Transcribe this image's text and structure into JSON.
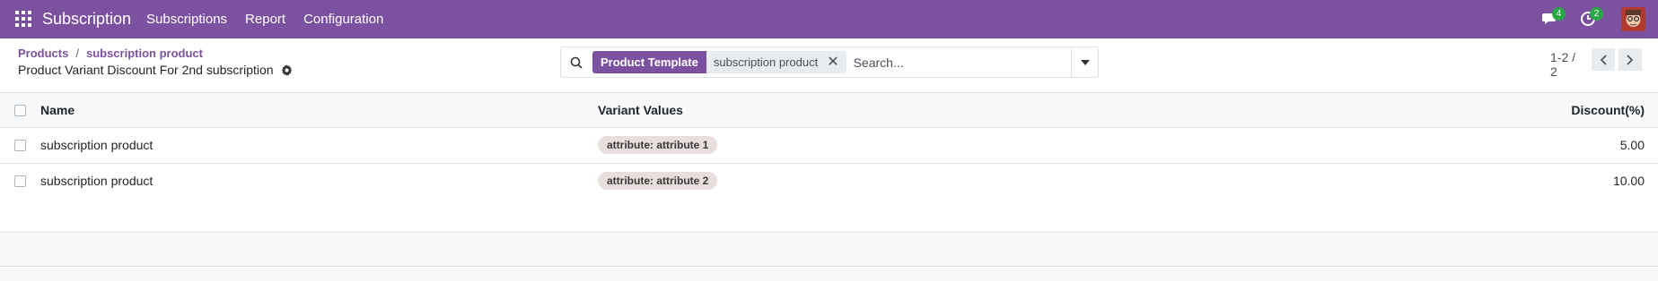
{
  "navbar": {
    "app_name": "Subscription",
    "menu": [
      "Subscriptions",
      "Report",
      "Configuration"
    ],
    "messages_count": "4",
    "activities_count": "2",
    "bg_color": "#7c519f"
  },
  "breadcrumb": {
    "items": [
      "Products",
      "subscription product"
    ],
    "separator": "/"
  },
  "page_title": "Product Variant Discount For 2nd subscription",
  "search": {
    "facet_label": "Product Template",
    "facet_value": "subscription product",
    "placeholder": "Search..."
  },
  "pager": {
    "value": "1-2 / 2"
  },
  "table": {
    "columns": [
      "Name",
      "Variant Values",
      "Discount(%)"
    ],
    "rows": [
      {
        "name": "subscription product",
        "variant": "attribute: attribute 1",
        "discount": "5.00"
      },
      {
        "name": "subscription product",
        "variant": "attribute: attribute 2",
        "discount": "10.00"
      }
    ]
  }
}
